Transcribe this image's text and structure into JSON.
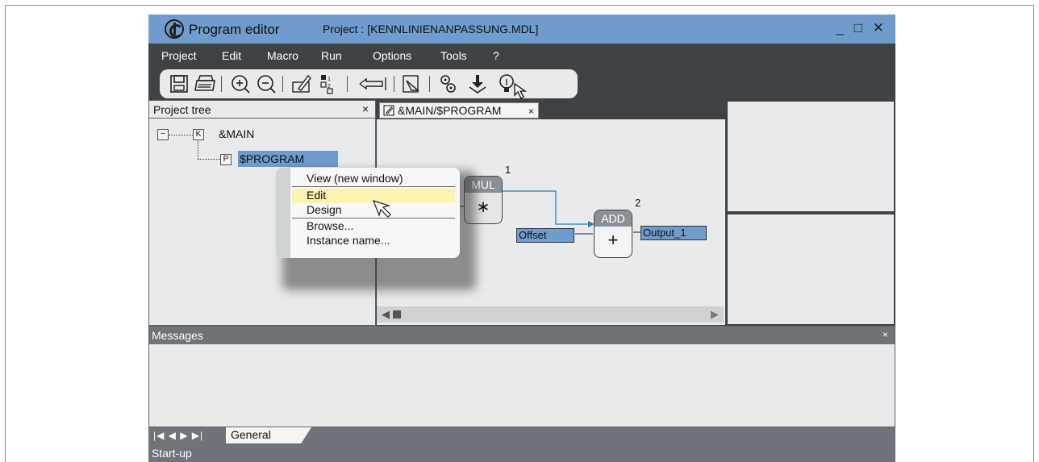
{
  "app": {
    "title": "Program editor",
    "project_label": "Project : [KENNLINIENANPASSUNG.MDL]",
    "window_controls": "_ □ ✕"
  },
  "menu": {
    "items": [
      "Project",
      "Edit",
      "Macro",
      "Run",
      "Options",
      "Tools",
      "?"
    ]
  },
  "toolbar": {
    "icons": [
      "save-icon",
      "print-icon",
      "zoom-in-icon",
      "zoom-out-icon",
      "edit-block-icon",
      "numbering-icon",
      "undo-icon",
      "copy-block-icon",
      "settings-icon",
      "download-icon",
      "lightbulb-icon"
    ]
  },
  "project_tree": {
    "title": "Project tree",
    "close": "×",
    "nodes": [
      {
        "badge": "K",
        "label": "&MAIN"
      },
      {
        "badge": "P",
        "label": "$PROGRAM"
      }
    ],
    "expander": "−"
  },
  "editor": {
    "tab_label": "&MAIN/$PROGRAM",
    "tab_close": "×",
    "blocks": {
      "mul": {
        "label": "MUL",
        "symbol": "∗",
        "number": "1"
      },
      "add": {
        "label": "ADD",
        "symbol": "+",
        "number": "2"
      }
    },
    "input_label": "Offset",
    "output_label": "Output_1",
    "scroll_left": "◀",
    "scroll_right": "▶"
  },
  "context_menu": {
    "items": [
      "View (new window)",
      "Edit",
      "Design",
      "Browse...",
      "Instance name..."
    ],
    "highlighted": "Edit"
  },
  "messages": {
    "title": "Messages",
    "close": "×"
  },
  "bottom_tabs": {
    "nav": "|◀ ◀ ▶ ▶|",
    "active_tab": "General"
  },
  "status": {
    "text": "Start-up"
  },
  "colors": {
    "titlebar": "#6f9bcd",
    "menubar": "#3f4246",
    "selection": "#6f9bcd",
    "highlight": "#fbf3b0",
    "wire": "#2a7fc0"
  }
}
